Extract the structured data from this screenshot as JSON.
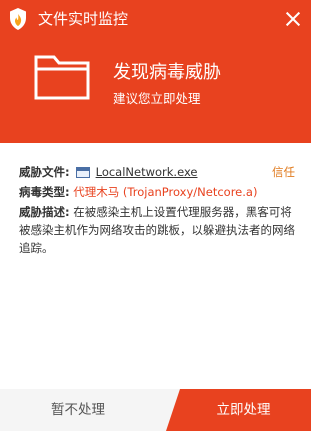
{
  "window": {
    "title": "文件实时监控"
  },
  "alert": {
    "headline": "发现病毒威胁",
    "subline": "建议您立即处理"
  },
  "details": {
    "file_label": "威胁文件:",
    "file_name": "LocalNetwork.exe",
    "trust_label": "信任",
    "virus_label": "病毒类型:",
    "virus_type": "代理木马 (TrojanProxy/Netcore.a)",
    "desc_label": "威胁描述:",
    "desc_text": "在被感染主机上设置代理服务器，黑客可将被感染主机作为网络攻击的跳板，以躲避执法者的网络追踪。"
  },
  "footer": {
    "ignore_label": "暂不处理",
    "handle_label": "立即处理"
  },
  "colors": {
    "accent": "#e8421f",
    "trust_link": "#e07b1f",
    "footer_bg": "#f5f5f5"
  },
  "icons": {
    "app": "shield-flame-icon",
    "close": "close-icon",
    "folder": "folder-icon",
    "file": "file-window-icon"
  }
}
